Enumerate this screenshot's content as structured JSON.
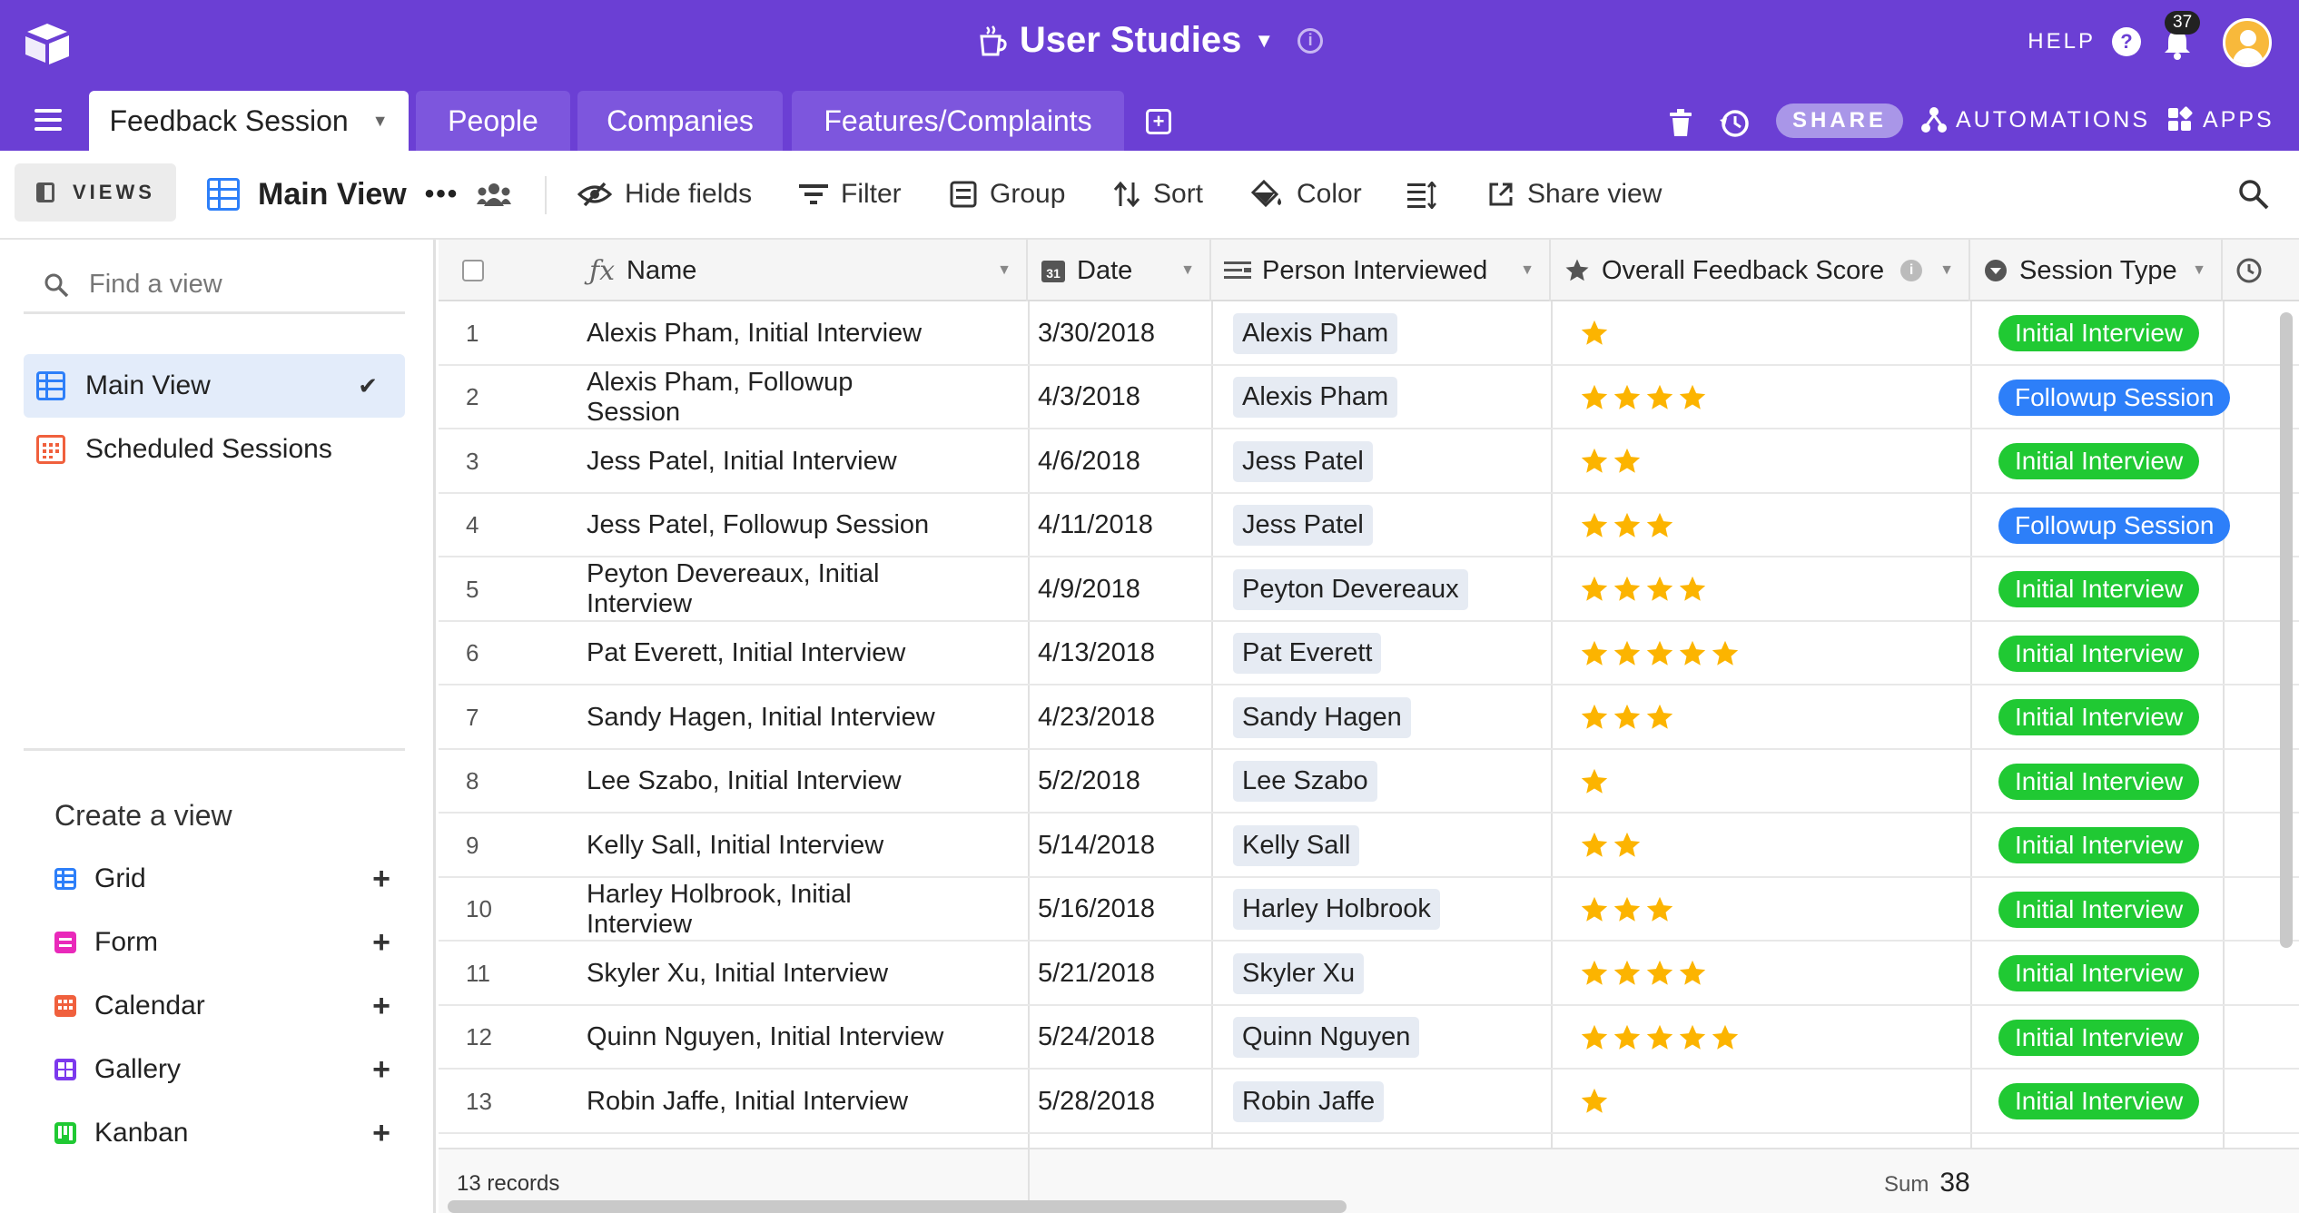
{
  "header": {
    "base_title": "User Studies",
    "help_label": "HELP",
    "notification_count": "37"
  },
  "tabs": [
    {
      "label": "Feedback Session",
      "active": true
    },
    {
      "label": "People",
      "active": false
    },
    {
      "label": "Companies",
      "active": false
    },
    {
      "label": "Features/Complaints",
      "active": false
    }
  ],
  "tabbar_actions": {
    "share_label": "SHARE",
    "automations_label": "AUTOMATIONS",
    "apps_label": "APPS"
  },
  "toolbar": {
    "views_label": "VIEWS",
    "current_view": "Main View",
    "hide_fields": "Hide fields",
    "filter": "Filter",
    "group": "Group",
    "sort": "Sort",
    "color": "Color",
    "share_view": "Share view"
  },
  "sidebar": {
    "find_placeholder": "Find a view",
    "views": [
      {
        "label": "Main View",
        "selected": true
      },
      {
        "label": "Scheduled Sessions",
        "selected": false
      }
    ],
    "create_title": "Create a view",
    "create_items": [
      "Grid",
      "Form",
      "Calendar",
      "Gallery",
      "Kanban"
    ]
  },
  "grid": {
    "columns": [
      "Name",
      "Date",
      "Person Interviewed",
      "Overall Feedback Score",
      "Session Type"
    ],
    "rows": [
      {
        "num": "1",
        "name": "Alexis Pham, Initial Interview",
        "date": "3/30/2018",
        "person": "Alexis Pham",
        "score": 1,
        "session": "Initial Interview"
      },
      {
        "num": "2",
        "name": "Alexis Pham, Followup Session",
        "date": "4/3/2018",
        "person": "Alexis Pham",
        "score": 4,
        "session": "Followup Session"
      },
      {
        "num": "3",
        "name": "Jess Patel, Initial Interview",
        "date": "4/6/2018",
        "person": "Jess Patel",
        "score": 2,
        "session": "Initial Interview"
      },
      {
        "num": "4",
        "name": "Jess Patel, Followup Session",
        "date": "4/11/2018",
        "person": "Jess Patel",
        "score": 3,
        "session": "Followup Session"
      },
      {
        "num": "5",
        "name": "Peyton Devereaux, Initial Interview",
        "date": "4/9/2018",
        "person": "Peyton Devereaux",
        "score": 4,
        "session": "Initial Interview"
      },
      {
        "num": "6",
        "name": "Pat Everett, Initial Interview",
        "date": "4/13/2018",
        "person": "Pat Everett",
        "score": 5,
        "session": "Initial Interview"
      },
      {
        "num": "7",
        "name": "Sandy Hagen, Initial Interview",
        "date": "4/23/2018",
        "person": "Sandy Hagen",
        "score": 3,
        "session": "Initial Interview"
      },
      {
        "num": "8",
        "name": "Lee Szabo, Initial Interview",
        "date": "5/2/2018",
        "person": "Lee Szabo",
        "score": 1,
        "session": "Initial Interview"
      },
      {
        "num": "9",
        "name": "Kelly Sall, Initial Interview",
        "date": "5/14/2018",
        "person": "Kelly Sall",
        "score": 2,
        "session": "Initial Interview"
      },
      {
        "num": "10",
        "name": "Harley Holbrook, Initial Interview",
        "date": "5/16/2018",
        "person": "Harley Holbrook",
        "score": 3,
        "session": "Initial Interview"
      },
      {
        "num": "11",
        "name": "Skyler Xu, Initial Interview",
        "date": "5/21/2018",
        "person": "Skyler Xu",
        "score": 4,
        "session": "Initial Interview"
      },
      {
        "num": "12",
        "name": "Quinn Nguyen, Initial Interview",
        "date": "5/24/2018",
        "person": "Quinn Nguyen",
        "score": 5,
        "session": "Initial Interview"
      },
      {
        "num": "13",
        "name": "Robin Jaffe, Initial Interview",
        "date": "5/28/2018",
        "person": "Robin Jaffe",
        "score": 1,
        "session": "Initial Interview"
      }
    ],
    "footer": {
      "records": "13 records",
      "sum_label": "Sum",
      "sum_value": "38"
    }
  },
  "colors": {
    "brand_purple": "#6b3fd4",
    "initial_interview": "#20c933",
    "followup_session": "#2d7ff9",
    "star": "#fcb400"
  }
}
